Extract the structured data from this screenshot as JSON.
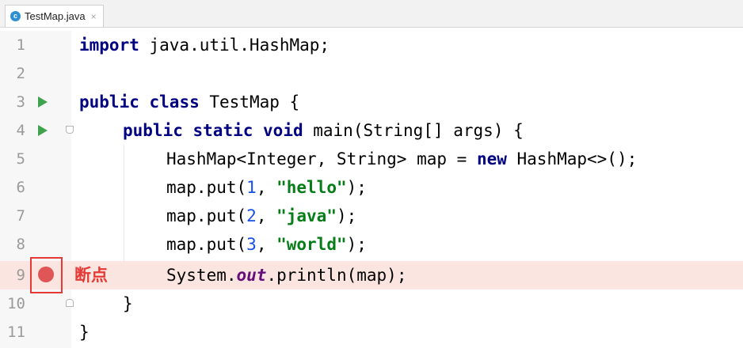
{
  "tab": {
    "filename": "TestMap.java",
    "icon_letter": "c",
    "close_glyph": "×"
  },
  "breakpoint": {
    "line": 9,
    "label": "断点",
    "color": "#e53935"
  },
  "lines": [
    {
      "n": "1"
    },
    {
      "n": "2"
    },
    {
      "n": "3"
    },
    {
      "n": "4"
    },
    {
      "n": "5"
    },
    {
      "n": "6"
    },
    {
      "n": "7"
    },
    {
      "n": "8"
    },
    {
      "n": "9"
    },
    {
      "n": "10"
    },
    {
      "n": "11"
    }
  ],
  "code": {
    "l1": {
      "kw": "import",
      "rest": " java.util.HashMap;"
    },
    "l3": {
      "kw1": "public",
      "kw2": "class",
      "rest": " TestMap {"
    },
    "l4": {
      "kw1": "public",
      "kw2": "static",
      "kw3": "void",
      "rest": " main(String[] args) {"
    },
    "l5": {
      "pre": "HashMap<Integer, String> map = ",
      "kw": "new",
      "post": " HashMap<>();"
    },
    "l6": {
      "pre": "map.put(",
      "num": "1",
      "mid": ", ",
      "str": "\"hello\"",
      "post": ");"
    },
    "l7": {
      "pre": "map.put(",
      "num": "2",
      "mid": ", ",
      "str": "\"java\"",
      "post": ");"
    },
    "l8": {
      "pre": "map.put(",
      "num": "3",
      "mid": ", ",
      "str": "\"world\"",
      "post": ");"
    },
    "l9": {
      "pre": "System.",
      "stat": "out",
      "post": ".println(map);"
    },
    "l10": {
      "text": "}"
    },
    "l11": {
      "text": "}"
    }
  }
}
